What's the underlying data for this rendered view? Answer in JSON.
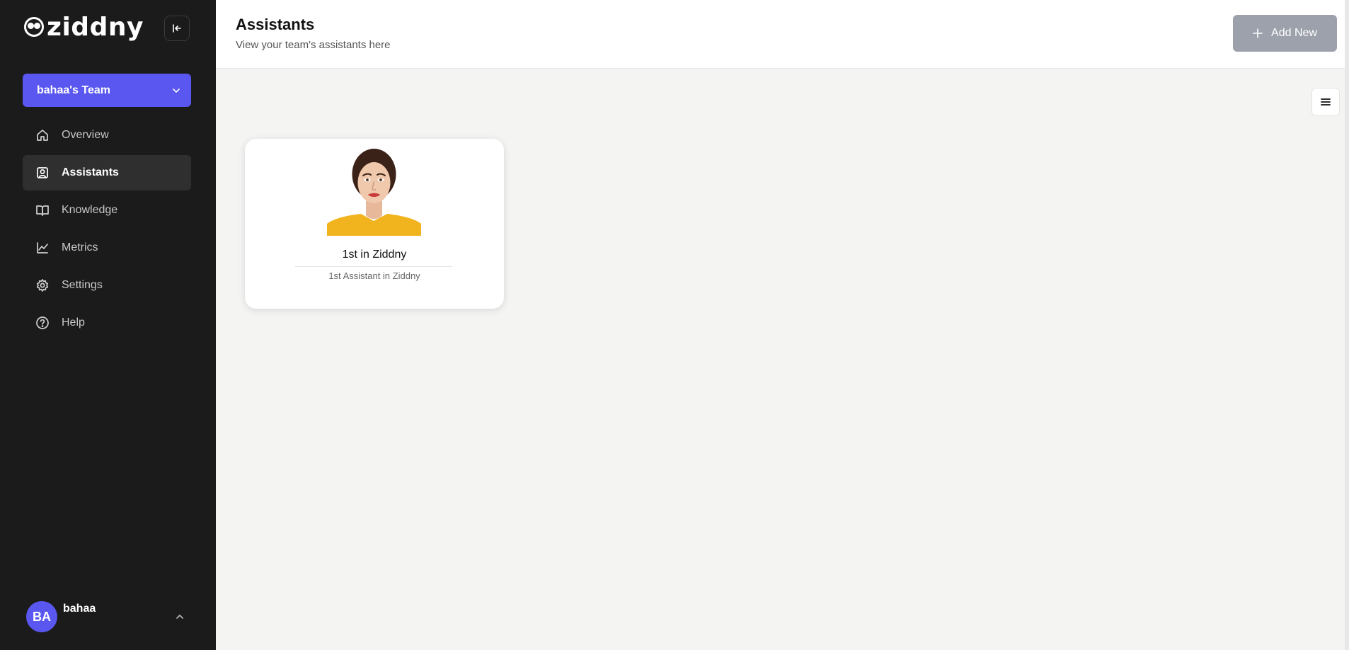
{
  "brand": {
    "name": "ziddny"
  },
  "team": {
    "label": "bahaa's Team"
  },
  "sidebar": {
    "items": [
      {
        "label": "Overview",
        "icon": "home-icon",
        "active": false
      },
      {
        "label": "Assistants",
        "icon": "user-square-icon",
        "active": true
      },
      {
        "label": "Knowledge",
        "icon": "book-icon",
        "active": false
      },
      {
        "label": "Metrics",
        "icon": "chart-line-icon",
        "active": false
      },
      {
        "label": "Settings",
        "icon": "gear-icon",
        "active": false
      },
      {
        "label": "Help",
        "icon": "help-circle-icon",
        "active": false
      }
    ]
  },
  "user": {
    "initials": "BA",
    "name": "bahaa"
  },
  "header": {
    "title": "Assistants",
    "subtitle": "View your team's assistants here",
    "add_label": "Add New"
  },
  "assistants": [
    {
      "name": "1st in Ziddny",
      "description": "1st Assistant in Ziddny"
    }
  ],
  "colors": {
    "sidebar_bg": "#1b1b1b",
    "accent": "#5a57f0",
    "add_button": "#9ca1ab",
    "main_bg": "#f4f4f3"
  }
}
